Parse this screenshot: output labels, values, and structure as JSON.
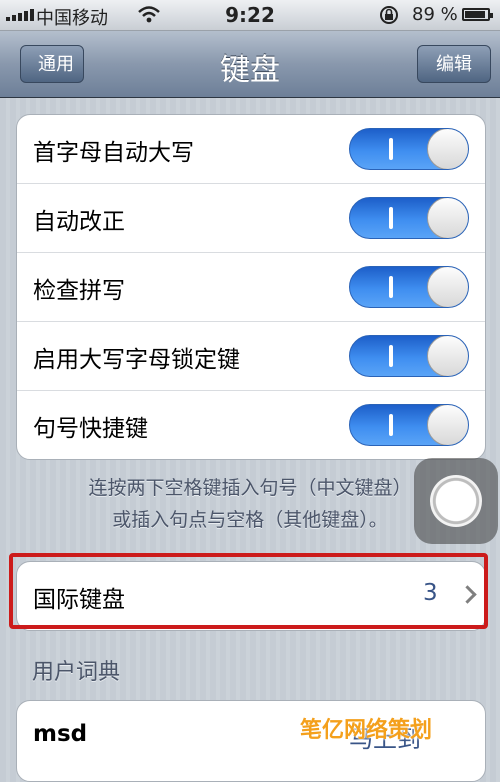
{
  "status_bar": {
    "carrier": "中国移动",
    "time": "9:22",
    "battery_percent": "89 %",
    "icons": [
      "signal-bars-icon",
      "wifi-icon",
      "rotation-lock-icon",
      "battery-icon"
    ]
  },
  "nav": {
    "back_label": "通用",
    "title": "键盘",
    "edit_label": "编辑"
  },
  "toggles": [
    {
      "label": "首字母自动大写",
      "on": true
    },
    {
      "label": "自动改正",
      "on": true
    },
    {
      "label": "检查拼写",
      "on": true
    },
    {
      "label": "启用大写字母锁定键",
      "on": true
    },
    {
      "label": "句号快捷键",
      "on": true
    }
  ],
  "shortcut_note": {
    "line1": "连按两下空格键插入句号（中文键盘）",
    "line2": "或插入句点与空格（其他键盘）。"
  },
  "international": {
    "label": "国际键盘",
    "value": "3"
  },
  "user_dictionary": {
    "header": "用户词典",
    "entries": [
      {
        "word": "msd",
        "reading": "马上到"
      }
    ]
  },
  "watermark_text": "笔亿网络策划",
  "colors": {
    "nav_bar": "#6d7f98",
    "toggle_on": "#3f8ef0",
    "highlight_box": "#cc1b1b",
    "value_text": "#385487"
  }
}
